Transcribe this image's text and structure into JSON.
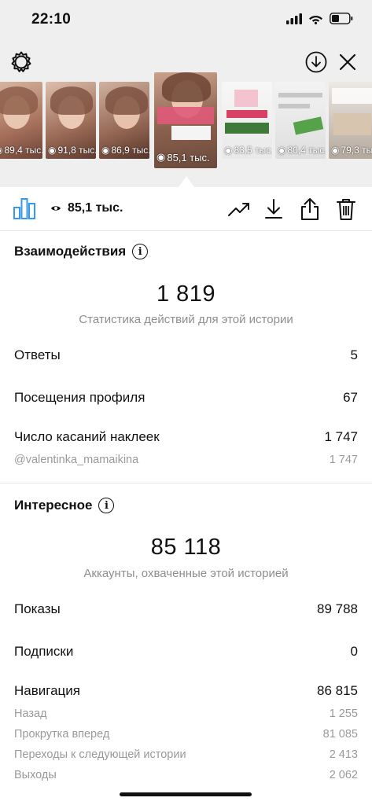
{
  "status_bar": {
    "time": "22:10",
    "icons": [
      "signal-icon",
      "wifi-icon",
      "battery-icon"
    ]
  },
  "header": {
    "icons": [
      "settings-icon",
      "download-circle-icon",
      "close-icon"
    ]
  },
  "thumbnails": [
    {
      "views": "89,4 тыс."
    },
    {
      "views": "91,8 тыс."
    },
    {
      "views": "86,9 тыс."
    },
    {
      "views": "85,1 тыс.",
      "selected": true
    },
    {
      "views": "83,5 тыс."
    },
    {
      "views": "80,4 тыс."
    },
    {
      "views": "79,3 тыс."
    }
  ],
  "toolbar": {
    "views": "85,1 тыс.",
    "icons": [
      "insights-bars-icon",
      "eye-icon",
      "trending-icon",
      "download-icon",
      "share-icon",
      "trash-icon"
    ]
  },
  "interactions": {
    "title": "Взаимодействия",
    "total": "1 819",
    "subtitle": "Статистика действий для этой истории",
    "rows": [
      {
        "label": "Ответы",
        "value": "5"
      },
      {
        "label": "Посещения профиля",
        "value": "67"
      },
      {
        "label": "Число касаний наклеек",
        "value": "1 747"
      }
    ],
    "sticker_rows": [
      {
        "label": "@valentinka_mamaikina",
        "value": "1 747"
      }
    ]
  },
  "discovery": {
    "title": "Интересное",
    "total": "85 118",
    "subtitle": "Аккаунты, охваченные этой историей",
    "rows": [
      {
        "label": "Показы",
        "value": "89 788"
      },
      {
        "label": "Подписки",
        "value": "0"
      },
      {
        "label": "Навигация",
        "value": "86 815"
      }
    ],
    "navigation_rows": [
      {
        "label": "Назад",
        "value": "1 255"
      },
      {
        "label": "Прокрутка вперед",
        "value": "81 085"
      },
      {
        "label": "Переходы к следующей истории",
        "value": "2 413"
      },
      {
        "label": "Выходы",
        "value": "2 062"
      }
    ]
  },
  "colors": {
    "accent": "#3897f0",
    "muted": "#8e8e8e",
    "background_top": "#efefef"
  }
}
